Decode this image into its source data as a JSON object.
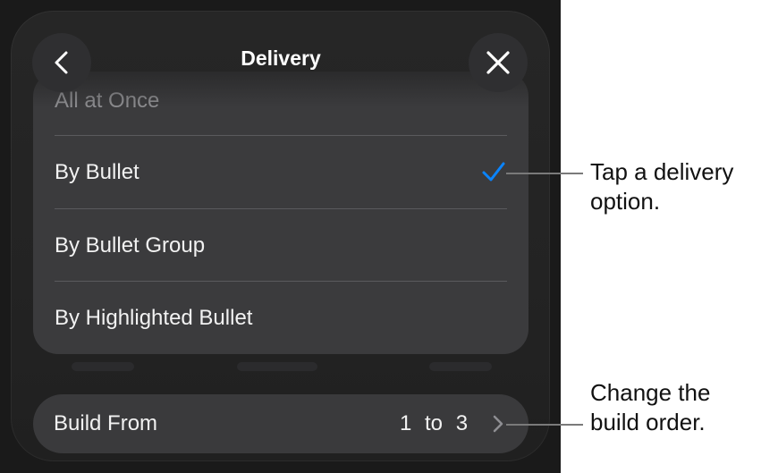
{
  "header": {
    "title": "Delivery",
    "back_icon": "chevron-left-icon",
    "close_icon": "close-icon"
  },
  "delivery_options": [
    {
      "label": "All at Once",
      "selected": false
    },
    {
      "label": "By Bullet",
      "selected": true
    },
    {
      "label": "By Bullet Group",
      "selected": false
    },
    {
      "label": "By Highlighted Bullet",
      "selected": false
    }
  ],
  "build_from": {
    "label": "Build From",
    "value": "1 to 3"
  },
  "callouts": {
    "delivery": "Tap a delivery option.",
    "build": "Change the build order."
  },
  "colors": {
    "accent": "#0a84ff",
    "panel": "#262626",
    "card": "#3b3b3d"
  }
}
